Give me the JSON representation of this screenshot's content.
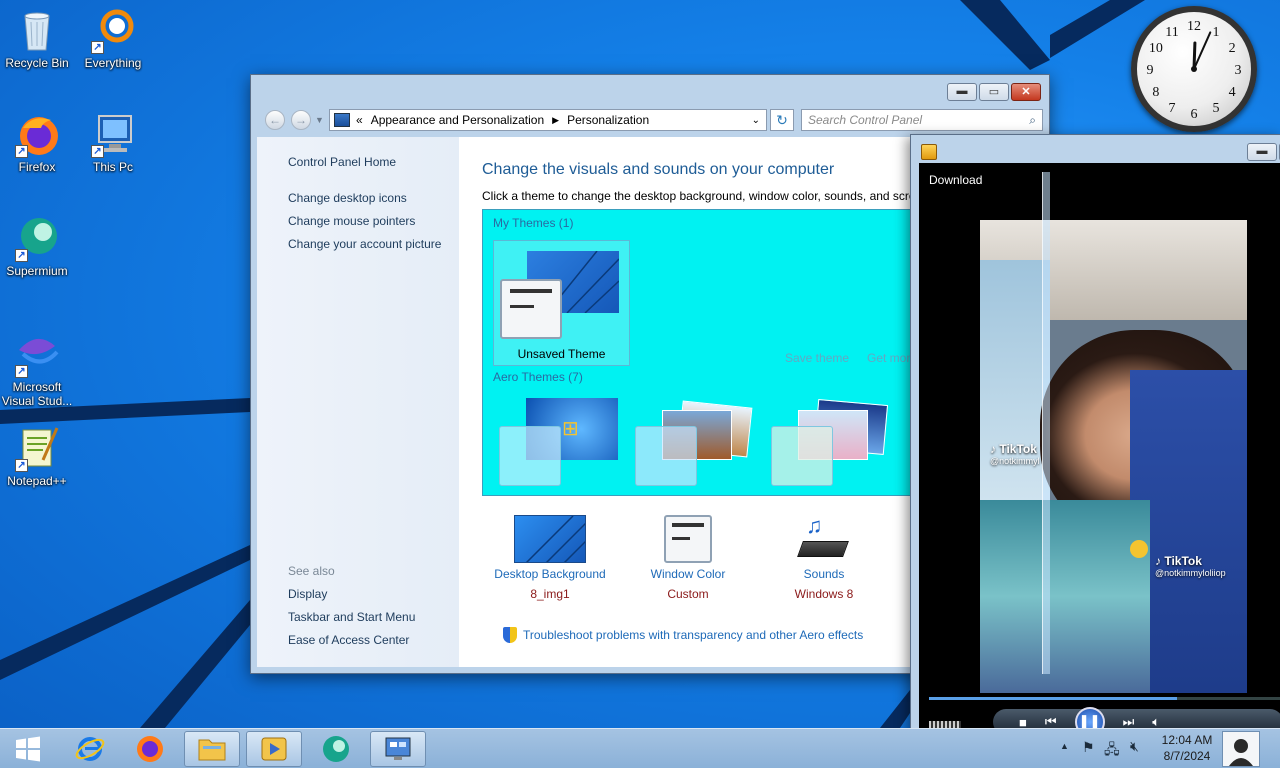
{
  "desktop": {
    "icons": [
      {
        "label": "Recycle Bin",
        "icon": "recycle-bin-icon"
      },
      {
        "label": "Everything",
        "icon": "everything-search-icon"
      },
      {
        "label": "Firefox",
        "icon": "firefox-icon"
      },
      {
        "label": "This Pc",
        "icon": "computer-icon"
      },
      {
        "label": "Supermium",
        "icon": "supermium-icon"
      },
      {
        "label": "Microsoft Visual Stud...",
        "icon": "visual-studio-icon"
      },
      {
        "label": "Notepad++",
        "icon": "notepadpp-icon"
      }
    ]
  },
  "clock": {
    "numerals": [
      "12",
      "1",
      "2",
      "3",
      "4",
      "5",
      "6",
      "7",
      "8",
      "9",
      "10",
      "11"
    ],
    "hours": 12,
    "minutes": 4
  },
  "control_panel": {
    "breadcrumb_prefix": "«",
    "breadcrumb": [
      "Appearance and Personalization",
      "Personalization"
    ],
    "search_placeholder": "Search Control Panel",
    "sidebar": {
      "links": [
        "Control Panel Home",
        "Change desktop icons",
        "Change mouse pointers",
        "Change your account picture"
      ],
      "see_also_label": "See also",
      "see_also": [
        "Display",
        "Taskbar and Start Menu",
        "Ease of Access Center"
      ]
    },
    "heading": "Change the visuals and sounds on your computer",
    "subheading": "Click a theme to change the desktop background, window color, sounds, and scre",
    "my_themes_title": "My Themes (1)",
    "my_theme_label": "Unsaved Theme",
    "save_theme": "Save theme",
    "get_more": "Get mor",
    "aero_themes_title": "Aero Themes (7)",
    "bottom": [
      {
        "title": "Desktop Background",
        "value": "8_img1",
        "icon": "desktop-background-icon"
      },
      {
        "title": "Window Color",
        "value": "Custom",
        "icon": "window-color-icon"
      },
      {
        "title": "Sounds",
        "value": "Windows 8",
        "icon": "sounds-icon"
      }
    ],
    "troubleshoot": "Troubleshoot problems with transparency and other Aero effects"
  },
  "media_player": {
    "download_label": "Download",
    "watermark_brand": "TikTok",
    "watermark_user_1": "@notkimmyl",
    "watermark_user_2": "@notkimmyloliiop",
    "progress_fraction": 0.7
  },
  "taskbar": {
    "time": "12:04 AM",
    "date": "8/7/2024"
  },
  "colors": {
    "theme_panel": "#00f2f2",
    "link_blue": "#1e6ab8",
    "value_red": "#8b1a1a",
    "heading_blue": "#1e5c96"
  }
}
